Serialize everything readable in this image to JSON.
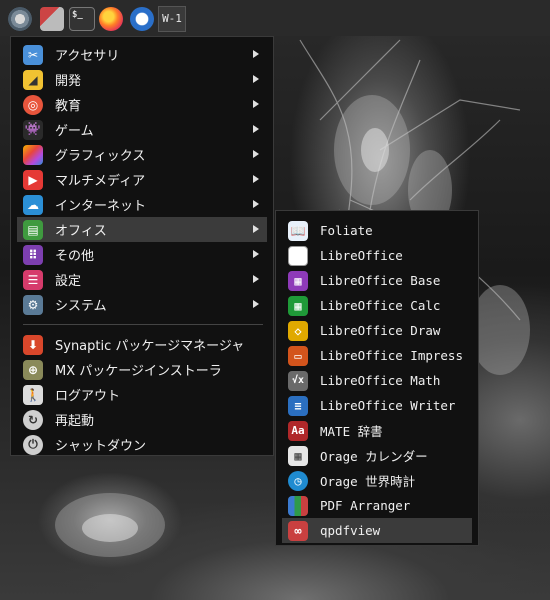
{
  "taskbar": {
    "terminal_glyph": "$_",
    "window_label": "W-1"
  },
  "menu": {
    "categories": [
      {
        "label": "アクセサリ",
        "icon": "scissors-icon",
        "color": "#4a90d9"
      },
      {
        "label": "開発",
        "icon": "development-icon",
        "color": "#f1c232"
      },
      {
        "label": "教育",
        "icon": "education-icon",
        "color": "#e8553c"
      },
      {
        "label": "ゲーム",
        "icon": "game-icon",
        "color": "#2a2a2a"
      },
      {
        "label": "グラフィックス",
        "icon": "graphics-icon",
        "color": "#b44ae0"
      },
      {
        "label": "マルチメディア",
        "icon": "multimedia-icon",
        "color": "#e53935"
      },
      {
        "label": "インターネット",
        "icon": "cloud-icon",
        "color": "#2b8fd6"
      },
      {
        "label": "オフィス",
        "icon": "office-icon",
        "color": "#3f9a3f"
      },
      {
        "label": "その他",
        "icon": "other-icon",
        "color": "#7d3fb0"
      },
      {
        "label": "設定",
        "icon": "settings-icon",
        "color": "#d63b6b"
      },
      {
        "label": "システム",
        "icon": "system-gear-icon",
        "color": "#5a7a96"
      }
    ],
    "actions": [
      {
        "label": "Synaptic パッケージマネージャ",
        "icon": "synaptic-icon",
        "color": "#d9472b"
      },
      {
        "label": "MX パッケージインストーラ",
        "icon": "package-installer-icon",
        "color": "#8a8a5a"
      },
      {
        "label": "ログアウト",
        "icon": "logout-icon",
        "color": "#dcdcdc"
      },
      {
        "label": "再起動",
        "icon": "restart-icon",
        "color": "#cfcfcf"
      },
      {
        "label": "シャットダウン",
        "icon": "shutdown-icon",
        "color": "#cfcfcf"
      }
    ]
  },
  "submenu": {
    "items": [
      {
        "label": "Foliate",
        "icon": "foliate-icon",
        "color": "#e8f1fb"
      },
      {
        "label": "LibreOffice",
        "icon": "libreoffice-icon",
        "color": "#ffffff"
      },
      {
        "label": "LibreOffice Base",
        "icon": "libreoffice-base-icon",
        "color": "#8e3ab8"
      },
      {
        "label": "LibreOffice Calc",
        "icon": "libreoffice-calc-icon",
        "color": "#1f9a38"
      },
      {
        "label": "LibreOffice Draw",
        "icon": "libreoffice-draw-icon",
        "color": "#e0a900"
      },
      {
        "label": "LibreOffice Impress",
        "icon": "libreoffice-impress-icon",
        "color": "#d3541c"
      },
      {
        "label": "LibreOffice Math",
        "icon": "libreoffice-math-icon",
        "color": "#6a6a6a"
      },
      {
        "label": "LibreOffice Writer",
        "icon": "libreoffice-writer-icon",
        "color": "#2b6fc0"
      },
      {
        "label": "MATE 辞書",
        "icon": "dictionary-icon",
        "color": "#b0282a"
      },
      {
        "label": "Orage カレンダー",
        "icon": "calendar-icon",
        "color": "#e6e6e6"
      },
      {
        "label": "Orage 世界時計",
        "icon": "clock-icon",
        "color": "#1f8bd0"
      },
      {
        "label": "PDF Arranger",
        "icon": "pdf-arranger-icon",
        "color": "#3b7bd0"
      },
      {
        "label": "qpdfview",
        "icon": "qpdfview-icon",
        "color": "#c94040"
      }
    ]
  },
  "dictionary_glyph": "Aa",
  "math_glyph": "√x"
}
